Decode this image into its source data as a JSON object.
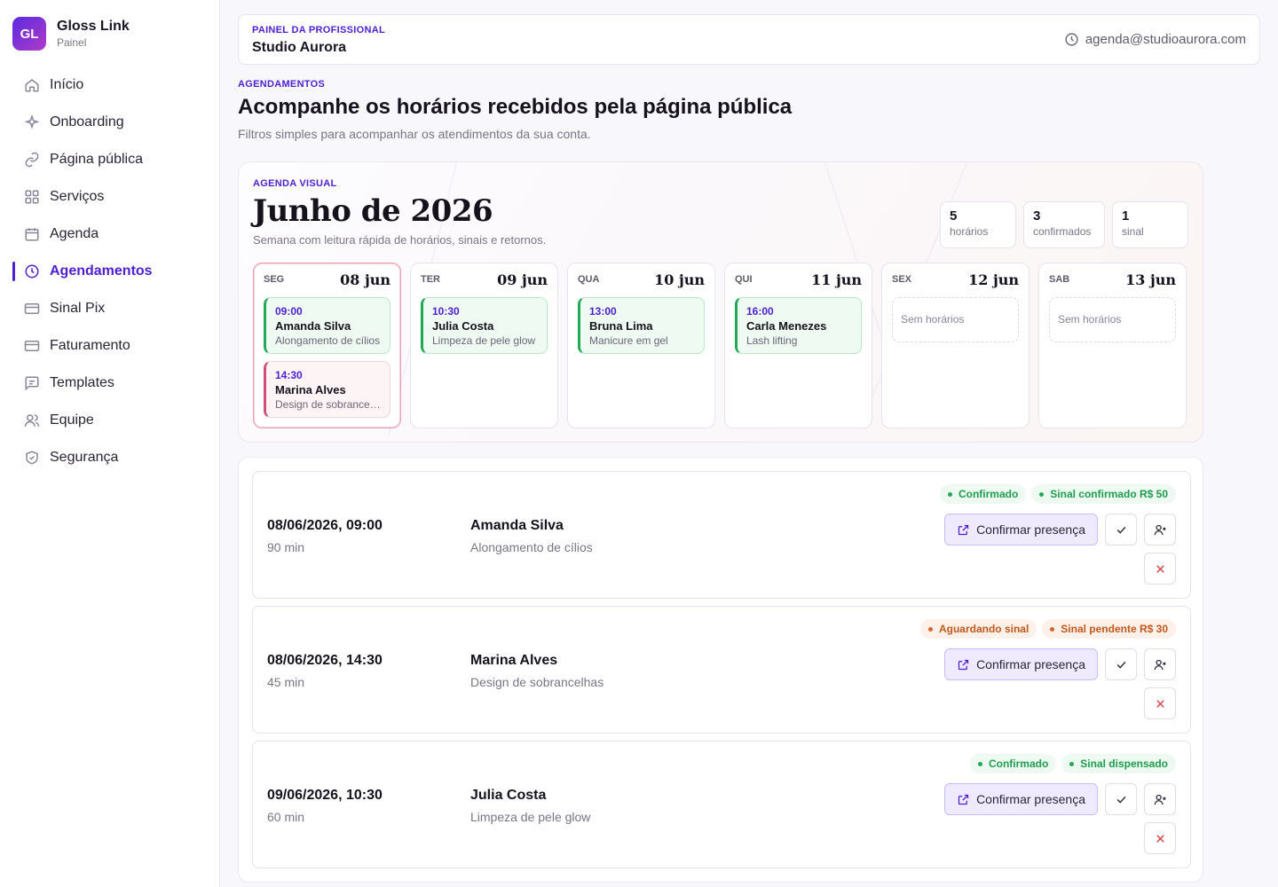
{
  "brand": {
    "logo": "GL",
    "name": "Gloss Link",
    "subtitle": "Painel"
  },
  "nav": [
    {
      "label": "Início",
      "icon": "home-icon",
      "active": false
    },
    {
      "label": "Onboarding",
      "icon": "sparkle-icon",
      "active": false
    },
    {
      "label": "Página pública",
      "icon": "link-icon",
      "active": false
    },
    {
      "label": "Serviços",
      "icon": "grid-icon",
      "active": false
    },
    {
      "label": "Agenda",
      "icon": "calendar-icon",
      "active": false
    },
    {
      "label": "Agendamentos",
      "icon": "clock-icon",
      "active": true
    },
    {
      "label": "Sinal Pix",
      "icon": "card-icon",
      "active": false
    },
    {
      "label": "Faturamento",
      "icon": "card-icon",
      "active": false
    },
    {
      "label": "Templates",
      "icon": "message-icon",
      "active": false
    },
    {
      "label": "Equipe",
      "icon": "users-icon",
      "active": false
    },
    {
      "label": "Segurança",
      "icon": "shield-icon",
      "active": false
    }
  ],
  "topbar": {
    "eyebrow": "PAINEL DA PROFISSIONAL",
    "studio": "Studio Aurora",
    "email": "agenda@studioaurora.com"
  },
  "section": {
    "eyebrow": "AGENDAMENTOS",
    "title": "Acompanhe os horários recebidos pela página pública",
    "description": "Filtros simples para acompanhar os atendimentos da sua conta."
  },
  "calendar": {
    "eyebrow": "AGENDA VISUAL",
    "title": "Junho de 2026",
    "description": "Semana com leitura rápida de horários, sinais e retornos.",
    "stats": [
      {
        "value": "5",
        "label": "horários"
      },
      {
        "value": "3",
        "label": "confirmados"
      },
      {
        "value": "1",
        "label": "sinal"
      }
    ],
    "days": [
      {
        "weekday": "SEG",
        "date": "08 jun",
        "appointments": [
          {
            "time": "09:00",
            "name": "Amanda Silva",
            "service": "Alongamento de cílios",
            "status": "confirmed"
          },
          {
            "time": "14:30",
            "name": "Marina Alves",
            "service": "Design de sobrancel...",
            "status": "pending"
          }
        ]
      },
      {
        "weekday": "TER",
        "date": "09 jun",
        "appointments": [
          {
            "time": "10:30",
            "name": "Julia Costa",
            "service": "Limpeza de pele glow",
            "status": "confirmed"
          }
        ]
      },
      {
        "weekday": "QUA",
        "date": "10 jun",
        "appointments": [
          {
            "time": "13:00",
            "name": "Bruna Lima",
            "service": "Manicure em gel",
            "status": "confirmed"
          }
        ]
      },
      {
        "weekday": "QUI",
        "date": "11 jun",
        "appointments": [
          {
            "time": "16:00",
            "name": "Carla Menezes",
            "service": "Lash lifting",
            "status": "confirmed"
          }
        ]
      },
      {
        "weekday": "SEX",
        "date": "12 jun",
        "appointments": [],
        "empty_label": "Sem horários"
      },
      {
        "weekday": "SAB",
        "date": "13 jun",
        "appointments": [],
        "empty_label": "Sem horários"
      }
    ]
  },
  "bookings": [
    {
      "datetime": "08/06/2026, 09:00",
      "duration": "90 min",
      "client": "Amanda Silva",
      "service": "Alongamento de cílios",
      "badges": [
        {
          "label": "Confirmado",
          "tone": "green"
        },
        {
          "label": "Sinal confirmado R$ 50",
          "tone": "green"
        }
      ],
      "confirm_label": "Confirmar presença"
    },
    {
      "datetime": "08/06/2026, 14:30",
      "duration": "45 min",
      "client": "Marina Alves",
      "service": "Design de sobrancelhas",
      "badges": [
        {
          "label": "Aguardando sinal",
          "tone": "orange"
        },
        {
          "label": "Sinal pendente R$ 30",
          "tone": "orange"
        }
      ],
      "confirm_label": "Confirmar presença"
    },
    {
      "datetime": "09/06/2026, 10:30",
      "duration": "60 min",
      "client": "Julia Costa",
      "service": "Limpeza de pele glow",
      "badges": [
        {
          "label": "Confirmado",
          "tone": "green"
        },
        {
          "label": "Sinal dispensado",
          "tone": "green"
        }
      ],
      "confirm_label": "Confirmar presença"
    }
  ],
  "colors": {
    "accent": "#4c1fd1",
    "success": "#22a957",
    "warning": "#d9632a",
    "danger": "#d14040"
  }
}
